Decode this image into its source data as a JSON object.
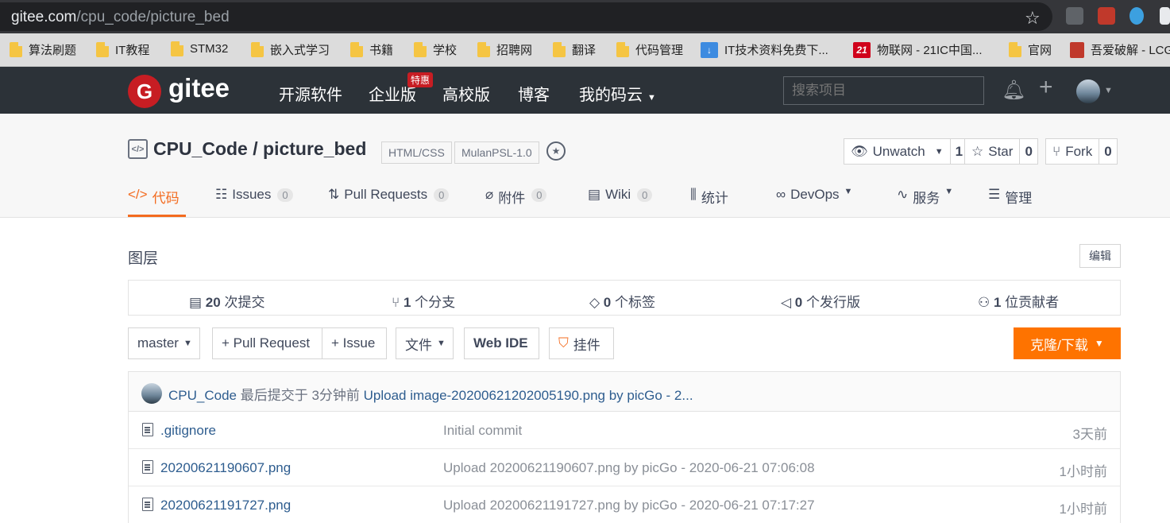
{
  "browser": {
    "url_host": "gitee.com",
    "url_path": "/cpu_code/picture_bed"
  },
  "bookmarks": [
    {
      "label": "算法刷题",
      "icon": "folder"
    },
    {
      "label": "IT教程",
      "icon": "folder"
    },
    {
      "label": "STM32",
      "icon": "folder"
    },
    {
      "label": "嵌入式学习",
      "icon": "folder"
    },
    {
      "label": "书籍",
      "icon": "folder"
    },
    {
      "label": "学校",
      "icon": "folder"
    },
    {
      "label": "招聘网",
      "icon": "folder"
    },
    {
      "label": "翻译",
      "icon": "folder"
    },
    {
      "label": "代码管理",
      "icon": "folder"
    },
    {
      "label": "IT技术资料免费下...",
      "icon": "download"
    },
    {
      "label": "物联网 - 21IC中国...",
      "icon": "21ic"
    },
    {
      "label": "官网",
      "icon": "folder"
    },
    {
      "label": "吾爱破解 - LCG",
      "icon": "52pojie"
    }
  ],
  "gitee": {
    "logo_letter": "G",
    "logo_text": "gitee",
    "nav": [
      "开源软件",
      "企业版",
      "高校版",
      "博客",
      "我的码云"
    ],
    "nav_tag": "特惠",
    "search_placeholder": "搜索项目"
  },
  "repo": {
    "icon_text": "</>",
    "title": "CPU_Code / picture_bed",
    "labels": [
      "HTML/CSS",
      "MulanPSL-1.0"
    ],
    "watch": {
      "label": "Unwatch",
      "count": "1"
    },
    "star": {
      "label": "Star",
      "count": "0"
    },
    "fork": {
      "label": "Fork",
      "count": "0"
    },
    "tabs": [
      {
        "label": "代码",
        "icon": "</>"
      },
      {
        "label": "Issues",
        "badge": "0"
      },
      {
        "label": "Pull Requests",
        "badge": "0"
      },
      {
        "label": "附件",
        "badge": "0"
      },
      {
        "label": "Wiki",
        "badge": "0"
      },
      {
        "label": "统计"
      },
      {
        "label": "DevOps"
      },
      {
        "label": "服务"
      },
      {
        "label": "管理"
      }
    ],
    "description": "图层",
    "edit_label": "编辑",
    "stats": [
      {
        "num": "20",
        "label": " 次提交"
      },
      {
        "num": "1",
        "label": " 个分支"
      },
      {
        "num": "0",
        "label": " 个标签"
      },
      {
        "num": "0",
        "label": " 个发行版"
      },
      {
        "num": "1",
        "label": " 位贡献者"
      }
    ],
    "toolbar": {
      "branch": "master",
      "pull_request": "+ Pull Request",
      "issue": "+ Issue",
      "file": "文件",
      "web_ide": "Web IDE",
      "widget": "挂件",
      "clone": "克隆/下载"
    },
    "last_commit": {
      "author": "CPU_Code",
      "meta": " 最后提交于 3分钟前 ",
      "message": "Upload image-20200621202005190.png by picGo - 2..."
    },
    "files": [
      {
        "name": ".gitignore",
        "message": "Initial commit",
        "time": "3天前"
      },
      {
        "name": "20200621190607.png",
        "message": "Upload 20200621190607.png by picGo - 2020-06-21 07:06:08",
        "time": "1小时前"
      },
      {
        "name": "20200621191727.png",
        "message": "Upload 20200621191727.png by picGo - 2020-06-21 07:17:27",
        "time": "1小时前"
      }
    ]
  }
}
